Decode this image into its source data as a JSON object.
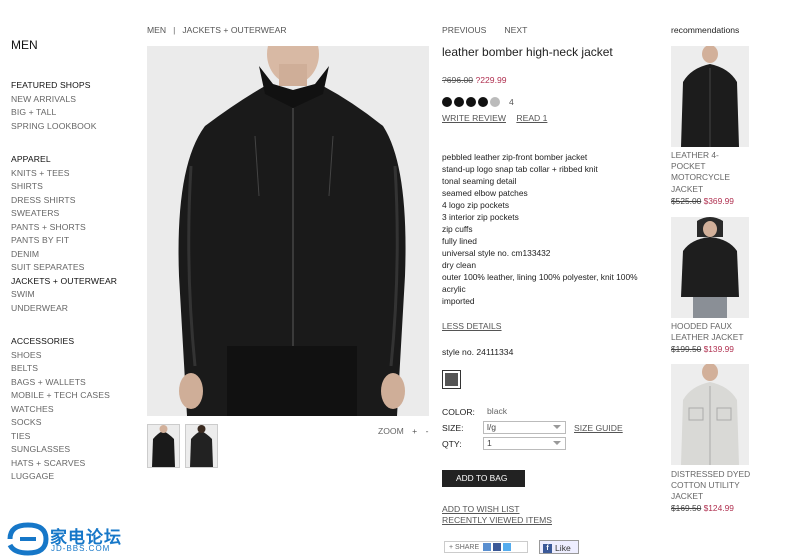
{
  "nav": {
    "title": "MEN",
    "featured_heading": "FEATURED SHOPS",
    "featured": [
      "NEW ARRIVALS",
      "BIG + TALL",
      "SPRING LOOKBOOK"
    ],
    "apparel_heading": "APPAREL",
    "apparel": [
      "KNITS + TEES",
      "SHIRTS",
      "DRESS SHIRTS",
      "SWEATERS",
      "PANTS + SHORTS",
      "PANTS BY FIT",
      "DENIM",
      "SUIT SEPARATES",
      "JACKETS + OUTERWEAR",
      "SWIM",
      "UNDERWEAR"
    ],
    "accessories_heading": "ACCESSORIES",
    "accessories": [
      "SHOES",
      "BELTS",
      "BAGS + WALLETS",
      "MOBILE + TECH CASES",
      "WATCHES",
      "SOCKS",
      "TIES",
      "SUNGLASSES",
      "HATS + SCARVES",
      "LUGGAGE"
    ]
  },
  "breadcrumb": {
    "root": "MEN",
    "sep": "|",
    "current": "JACKETS + OUTERWEAR"
  },
  "zoom": {
    "label": "ZOOM",
    "plus": "+",
    "minus": "-"
  },
  "product": {
    "previous": "PREVIOUS",
    "next": "NEXT",
    "title": "leather bomber high-neck jacket",
    "old_price": "?696.00",
    "new_price": "?229.99",
    "rating": 4,
    "rating_max": 5,
    "rating_count": "4",
    "write_review": "WRITE REVIEW",
    "read_reviews": "READ 1",
    "details": [
      "pebbled leather zip-front bomber jacket",
      "stand-up logo snap tab collar + ribbed knit",
      "tonal seaming detail",
      "seamed elbow patches",
      "4 logo zip pockets",
      "3 interior zip pockets",
      "zip cuffs",
      "fully lined",
      "universal style no. cm133432",
      "dry clean",
      "outer 100% leather, lining 100% polyester, knit 100% acrylic",
      "imported"
    ],
    "less_details": "LESS DETAILS",
    "style_no": "style no. 24111334",
    "swatch_color": "#555555",
    "color_label": "COLOR:",
    "color_value": "black",
    "size_label": "SIZE:",
    "size_value": "l/g",
    "size_guide": "SIZE GUIDE",
    "qty_label": "QTY:",
    "qty_value": "1",
    "add_to_bag": "ADD TO BAG",
    "add_to_wishlist": "ADD TO WISH LIST",
    "recently_viewed": "RECENTLY VIEWED ITEMS",
    "share": "+ SHARE",
    "like": "Like"
  },
  "recommendations": {
    "title": "recommendations",
    "items": [
      {
        "name": "LEATHER 4-POCKET MOTORCYCLE JACKET",
        "old": "$525.00",
        "new": "$369.99"
      },
      {
        "name": "HOODED FAUX LEATHER JACKET",
        "old": "$199.50",
        "new": "$139.99"
      },
      {
        "name": "DISTRESSED DYED COTTON UTILITY JACKET",
        "old": "$169.50",
        "new": "$124.99"
      }
    ]
  },
  "watermark": {
    "text": "家电论坛",
    "sub": "JD-BBS.COM"
  },
  "colors": {
    "accent_price": "#b03050",
    "button_bg": "#222222",
    "watermark": "#1677c8"
  }
}
